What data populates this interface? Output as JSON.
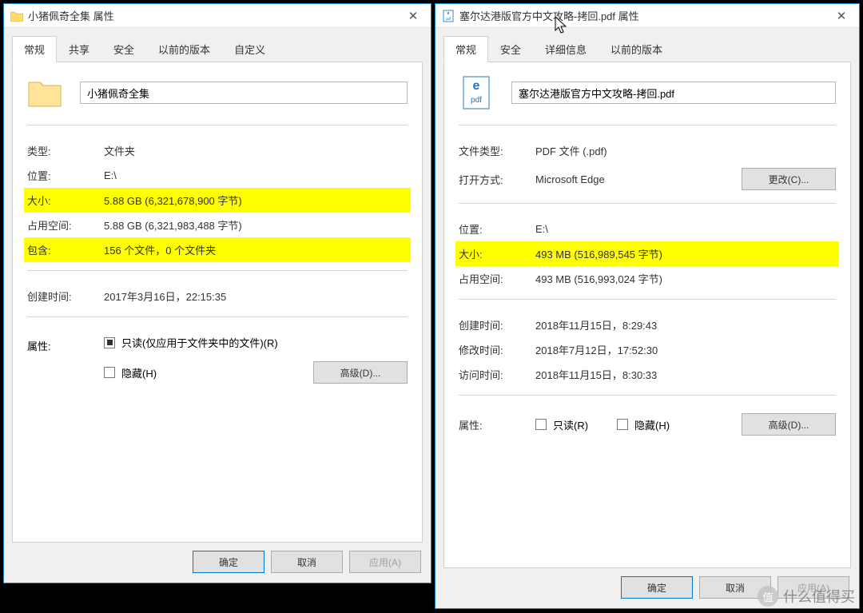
{
  "left": {
    "title": "小猪佩奇全集 属性",
    "tabs": [
      "常规",
      "共享",
      "安全",
      "以前的版本",
      "自定义"
    ],
    "nameValue": "小猪佩奇全集",
    "rows": {
      "type_lbl": "类型:",
      "type_val": "文件夹",
      "loc_lbl": "位置:",
      "loc_val": "E:\\",
      "size_lbl": "大小:",
      "size_val": "5.88 GB (6,321,678,900 字节)",
      "disk_lbl": "占用空间:",
      "disk_val": "5.88 GB (6,321,983,488 字节)",
      "contains_lbl": "包含:",
      "contains_val": "156 个文件，0 个文件夹",
      "created_lbl": "创建时间:",
      "created_val": "2017年3月16日，22:15:35",
      "attr_lbl": "属性:",
      "readonly_lbl": "只读(仅应用于文件夹中的文件)(R)",
      "hidden_lbl": "隐藏(H)",
      "advanced_btn": "高级(D)..."
    },
    "footer": {
      "ok": "确定",
      "cancel": "取消",
      "apply": "应用(A)"
    }
  },
  "right": {
    "title": "塞尔达港版官方中文攻略-拷回.pdf 属性",
    "tabs": [
      "常规",
      "安全",
      "详细信息",
      "以前的版本"
    ],
    "nameValue": "塞尔达港版官方中文攻略-拷回.pdf",
    "rows": {
      "filetype_lbl": "文件类型:",
      "filetype_val": "PDF 文件 (.pdf)",
      "open_lbl": "打开方式:",
      "open_val": "Microsoft Edge",
      "change_btn": "更改(C)...",
      "loc_lbl": "位置:",
      "loc_val": "E:\\",
      "size_lbl": "大小:",
      "size_val": "493 MB (516,989,545 字节)",
      "disk_lbl": "占用空间:",
      "disk_val": "493 MB (516,993,024 字节)",
      "created_lbl": "创建时间:",
      "created_val": "2018年11月15日，8:29:43",
      "modified_lbl": "修改时间:",
      "modified_val": "2018年7月12日，17:52:30",
      "accessed_lbl": "访问时间:",
      "accessed_val": "2018年11月15日，8:30:33",
      "attr_lbl": "属性:",
      "readonly_lbl": "只读(R)",
      "hidden_lbl": "隐藏(H)",
      "advanced_btn": "高级(D)..."
    },
    "footer": {
      "ok": "确定",
      "cancel": "取消",
      "apply": "应用(A)"
    }
  },
  "watermark": {
    "badge": "值",
    "text": "什么值得买"
  }
}
